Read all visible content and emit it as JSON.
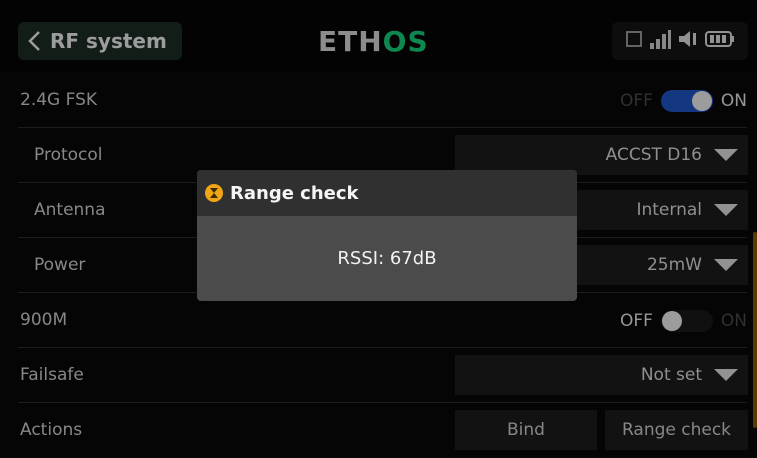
{
  "header": {
    "title": "RF system",
    "logo_part1": "ETH",
    "logo_part2": "OS",
    "status_icons": [
      "lock-icon",
      "signal-icon",
      "speaker-icon",
      "battery-icon"
    ]
  },
  "rows": {
    "fsk": {
      "label": "2.4G FSK",
      "toggle_off": "OFF",
      "toggle_on": "ON",
      "state": "on"
    },
    "protocol": {
      "label": "Protocol",
      "value": "ACCST D16"
    },
    "antenna": {
      "label": "Antenna",
      "value": "Internal"
    },
    "power": {
      "label": "Power",
      "value": "25mW"
    },
    "m900": {
      "label": "900M",
      "toggle_off": "OFF",
      "toggle_on": "ON",
      "state": "off"
    },
    "failsafe": {
      "label": "Failsafe",
      "value": "Not set"
    },
    "actions": {
      "label": "Actions",
      "bind": "Bind",
      "range_check": "Range check"
    }
  },
  "dialog": {
    "title": "Range check",
    "message": "RSSI: 67dB"
  },
  "colors": {
    "accent_green": "#17d17c",
    "toggle_blue": "#1f55c8",
    "dialog_icon": "#f0a516"
  }
}
